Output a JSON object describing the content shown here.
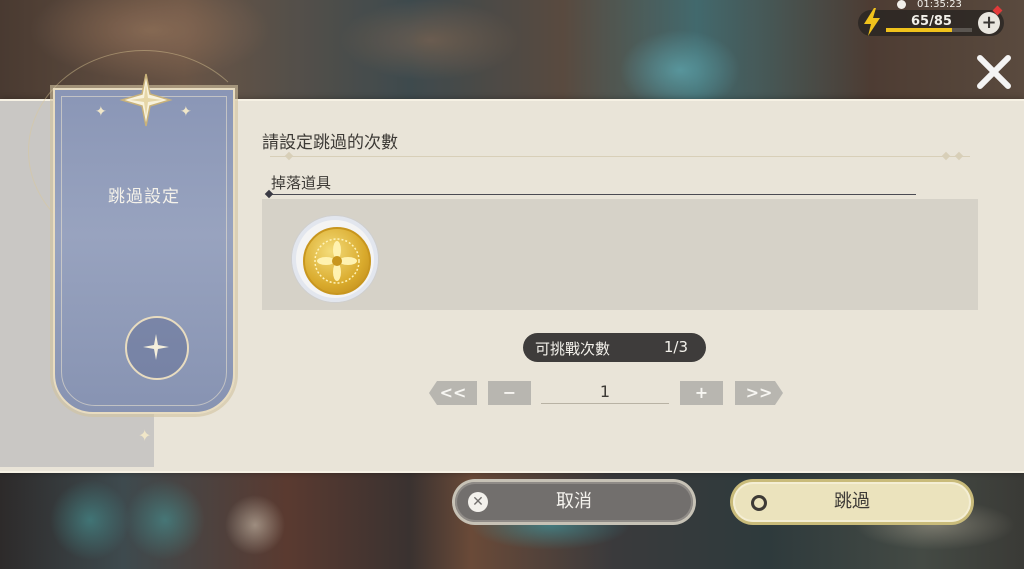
{
  "hud": {
    "time": "01:35:23",
    "stamina_text": "65/85",
    "stamina_fraction": 0.765,
    "accent_color": "#f0c21c",
    "icons": [
      "clock-icon",
      "lightning-icon",
      "plus-icon",
      "close-icon"
    ]
  },
  "banner": {
    "title": "跳過設定",
    "icons": [
      "compass-star-icon",
      "sparkle-icon"
    ]
  },
  "main": {
    "heading": "請設定跳過的次數",
    "drops_label": "掉落道具",
    "items": [
      {
        "icon": "gold-coin-icon"
      }
    ]
  },
  "challenge": {
    "label": "可挑戰次數",
    "value": "1/3"
  },
  "stepper": {
    "min_label": "<<",
    "minus_label": "−",
    "value": "1",
    "plus_label": "+",
    "max_label": ">>"
  },
  "buttons": {
    "cancel_label": "取消",
    "skip_label": "跳過"
  }
}
